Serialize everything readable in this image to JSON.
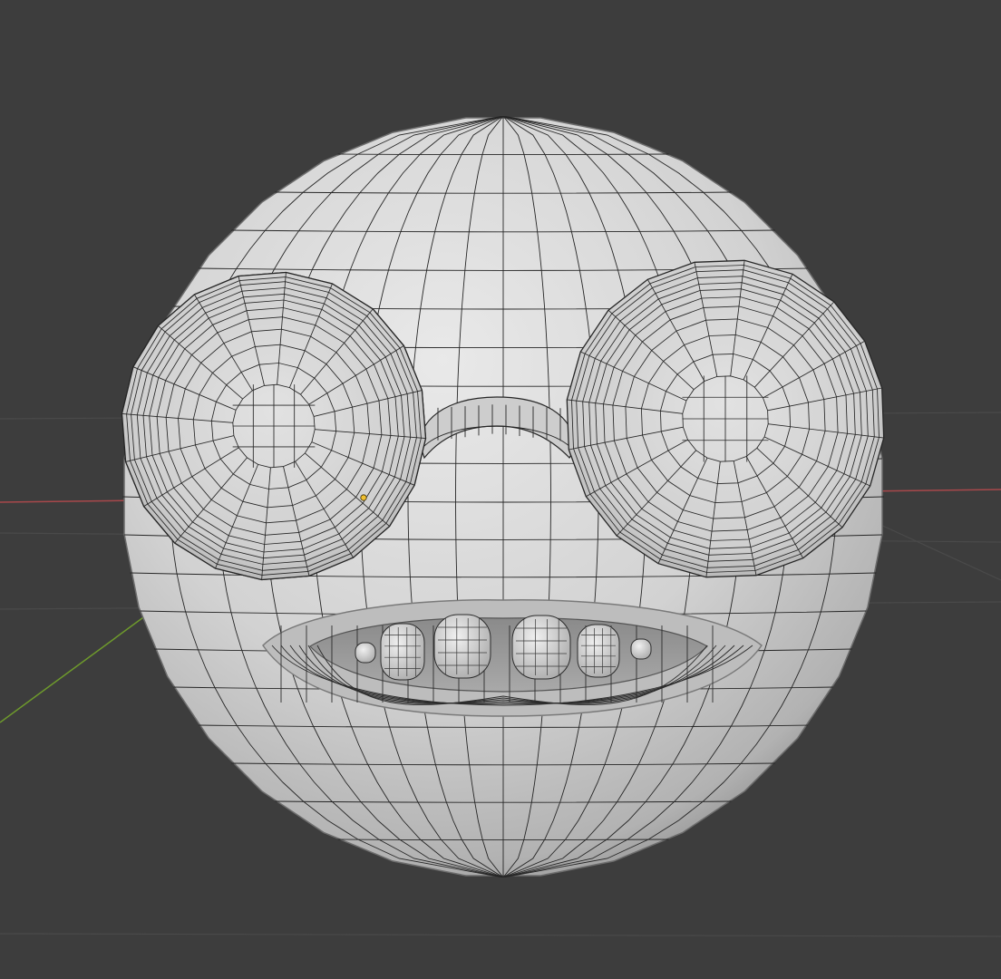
{
  "viewport": {
    "background": "#3d3d3d",
    "grid_color": "#4a4a4a",
    "x_axis_color": "#a8484b",
    "y_axis_color": "#6e9a2c",
    "origin_dot_color": "#f0c030"
  },
  "model": {
    "surface_color": "#d2d2d2",
    "shadow_color": "#7d7d7d",
    "wire_color": "#262626",
    "parts": [
      "head",
      "left-lens",
      "right-lens",
      "nose-bridge",
      "mouth",
      "teeth"
    ]
  }
}
